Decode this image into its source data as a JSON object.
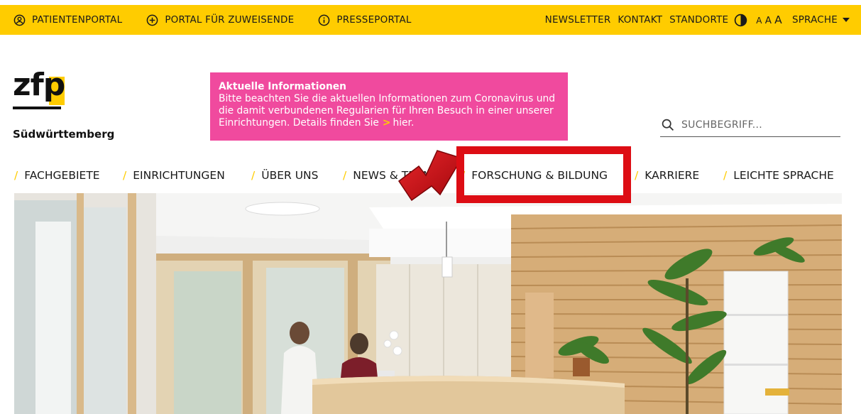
{
  "topbar": {
    "left_links": [
      {
        "label": "PATIENTENPORTAL",
        "icon": "person-circle-icon"
      },
      {
        "label": "PORTAL FÜR ZUWEISENDE",
        "icon": "plus-circle-icon"
      },
      {
        "label": "PRESSEPORTAL",
        "icon": "info-circle-icon"
      }
    ],
    "right_links": {
      "newsletter": "NEWSLETTER",
      "kontakt": "KONTAKT",
      "standorte": "STANDORTE"
    },
    "font_sizes": [
      "A",
      "A",
      "A"
    ],
    "language_label": "SPRACHE"
  },
  "logo": {
    "letters": "zfp",
    "subtitle": "Südwürttemberg"
  },
  "notice": {
    "title": "Aktuelle Informationen",
    "text": "Bitte beachten Sie die aktuellen Informationen zum Coronavirus und die damit verbundenen Regularien für Ihren Besuch in einer unserer Einrichtungen. Details finden Sie",
    "link": "hier."
  },
  "search": {
    "placeholder": "SUCHBEGRIFF..."
  },
  "nav": {
    "items": [
      "FACHGEBIETE",
      "EINRICHTUNGEN",
      "ÜBER UNS",
      "NEWS & TERMINE",
      "FORSCHUNG & BILDUNG",
      "KARRIERE",
      "LEICHTE SPRACHE"
    ],
    "separator": "/"
  },
  "colors": {
    "accent_yellow": "#ffcc00",
    "notice_pink": "#f04a9e",
    "highlight_red": "#dd0d14"
  }
}
